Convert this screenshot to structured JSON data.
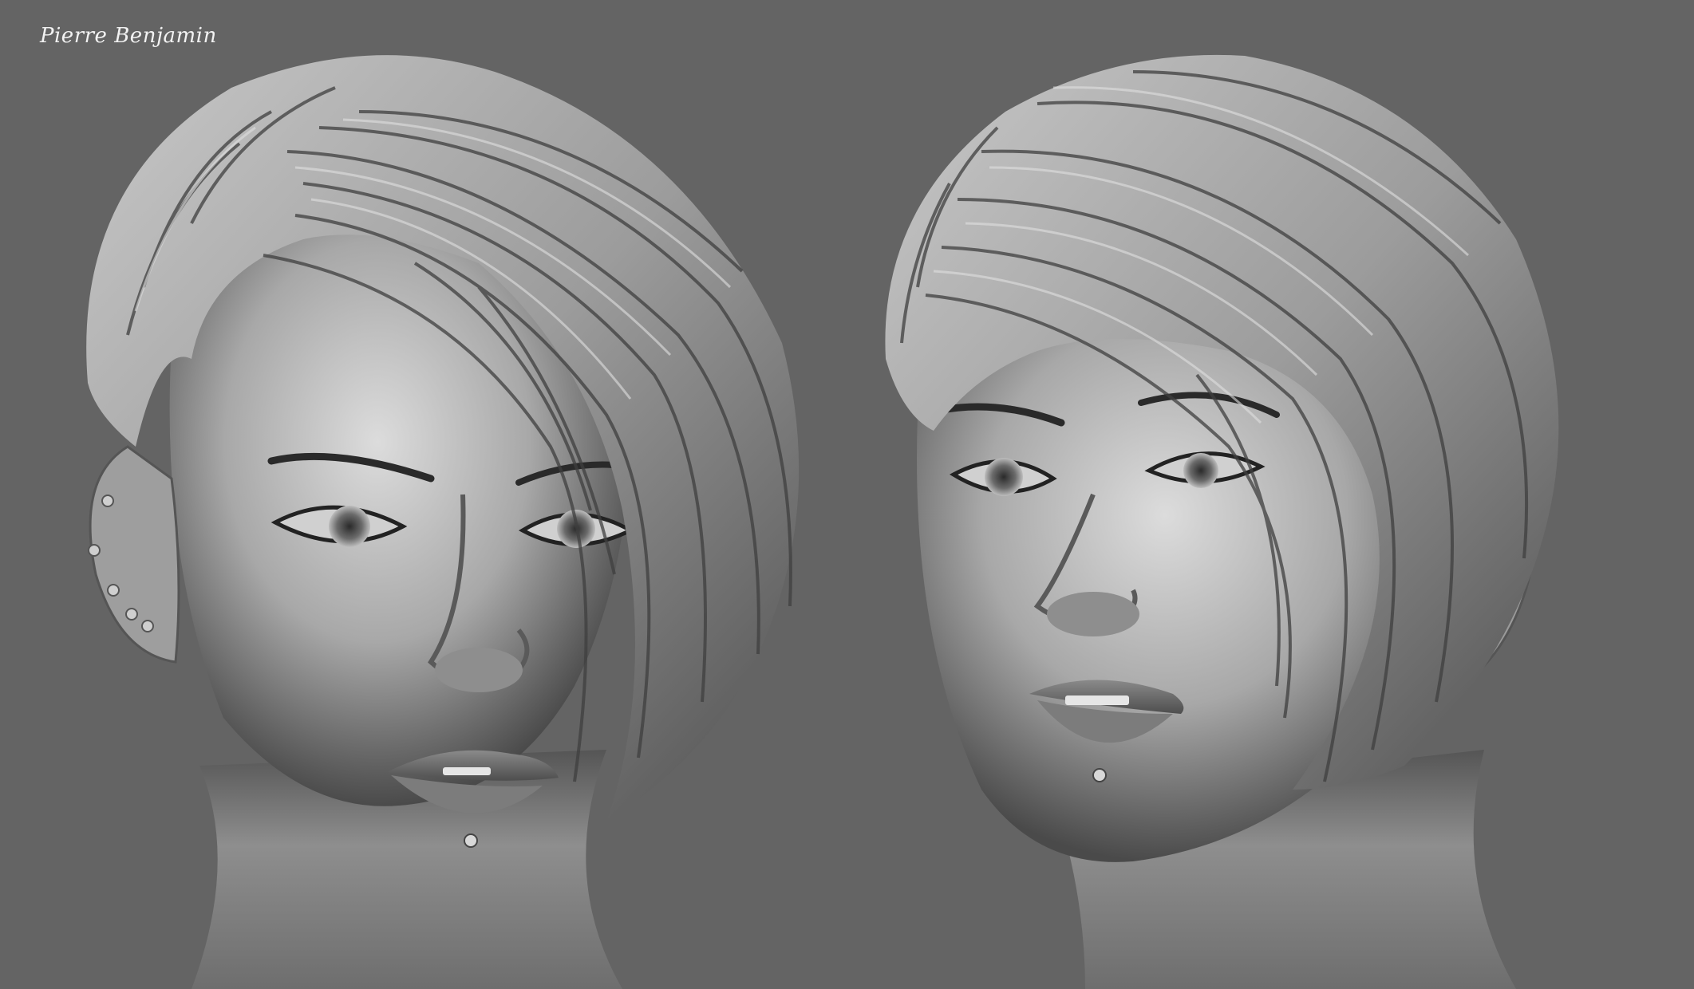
{
  "signature": "Pierre Benjamin",
  "colors": {
    "background": "#646464",
    "clay_light": "#d6d6d6",
    "clay_mid": "#9a9a9a",
    "clay_dark": "#3c3c3c"
  },
  "views": [
    "front-view-bust",
    "three-quarter-view-bust"
  ]
}
